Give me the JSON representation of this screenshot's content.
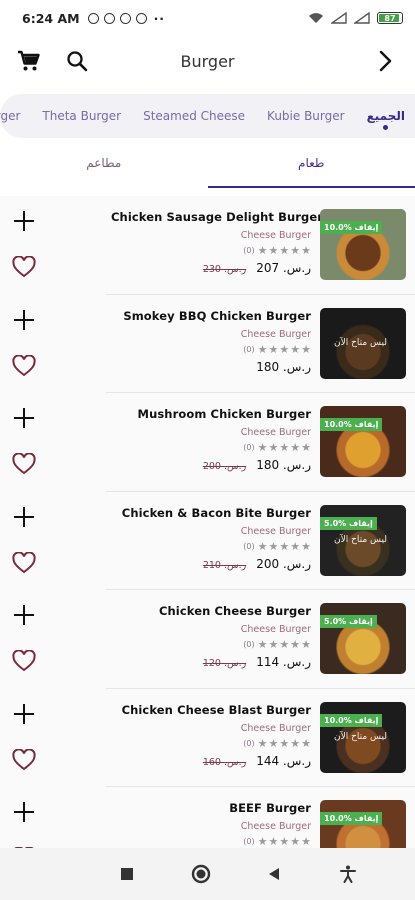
{
  "status": {
    "time": "6:24 AM",
    "battery": "87"
  },
  "appbar": {
    "title": "Burger",
    "icons": [
      "cart-icon",
      "search-icon",
      "chevron-right-icon"
    ]
  },
  "categories": [
    {
      "label": "tburger"
    },
    {
      "label": "Theta Burger"
    },
    {
      "label": "Steamed Cheese"
    },
    {
      "label": "Kubie Burger"
    },
    {
      "label": "الجميع",
      "active": true
    }
  ],
  "tabs": {
    "restaurants": "مطاعم",
    "food": "طعام"
  },
  "products": [
    {
      "name": "Chicken Sausage Delight Burger",
      "category": "Cheese Burger",
      "reviews": "(0)",
      "price": "ر.س. 207",
      "old_price": "ر.س. 230",
      "badge": "10.0% إيقاف",
      "overlay": ""
    },
    {
      "name": "Smokey BBQ Chicken Burger",
      "category": "Cheese Burger",
      "reviews": "(0)",
      "price": "ر.س. 180",
      "old_price": "",
      "badge": "",
      "overlay": "ليس متاح الآن"
    },
    {
      "name": "Mushroom Chicken Burger",
      "category": "Cheese Burger",
      "reviews": "(0)",
      "price": "ر.س. 180",
      "old_price": "ر.س. 200",
      "badge": "10.0% إيقاف",
      "overlay": ""
    },
    {
      "name": "Chicken & Bacon Bite Burger",
      "category": "Cheese Burger",
      "reviews": "(0)",
      "price": "ر.س. 200",
      "old_price": "ر.س. 210",
      "badge": "5.0% إيقاف",
      "overlay": "ليس متاح الآن"
    },
    {
      "name": "Chicken Cheese Burger",
      "category": "Cheese Burger",
      "reviews": "(0)",
      "price": "ر.س. 114",
      "old_price": "ر.س. 120",
      "badge": "5.0% إيقاف",
      "overlay": ""
    },
    {
      "name": "Chicken Cheese Blast Burger",
      "category": "Cheese Burger",
      "reviews": "(0)",
      "price": "ر.س. 144",
      "old_price": "ر.س. 160",
      "badge": "10.0% إيقاف",
      "overlay": "ليس متاح الآن"
    },
    {
      "name": "BEEF Burger",
      "category": "Cheese Burger",
      "reviews": "(0)",
      "price": "",
      "old_price": "",
      "badge": "10.0% إيقاف",
      "overlay": ""
    }
  ],
  "colors": {
    "accent": "#3a2a8c",
    "heart": "#7b2a3a",
    "badge": "#4caf50"
  }
}
